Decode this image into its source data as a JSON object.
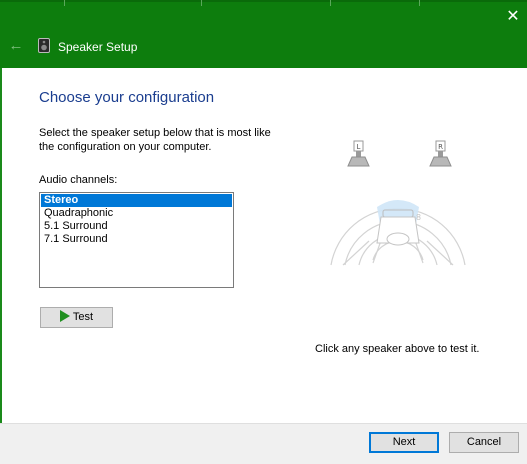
{
  "window": {
    "title": "Speaker Setup",
    "close_glyph": "✕",
    "back_glyph": "←"
  },
  "main": {
    "heading": "Choose your configuration",
    "description": "Select the speaker setup below that is most like the configuration on your computer.",
    "channels_label": "Audio channels:",
    "channels": [
      {
        "label": "Stereo",
        "selected": true
      },
      {
        "label": "Quadraphonic",
        "selected": false
      },
      {
        "label": "5.1 Surround",
        "selected": false
      },
      {
        "label": "7.1 Surround",
        "selected": false
      }
    ],
    "test_label": "Test",
    "hint": "Click any speaker above to test it."
  },
  "diagram": {
    "left_speaker_letter": "L",
    "right_speaker_letter": "R"
  },
  "footer": {
    "next_label": "Next",
    "cancel_label": "Cancel"
  },
  "colors": {
    "titlebar": "#0d7d0d",
    "accent": "#0078d7",
    "heading": "#1a3d8f",
    "play": "#1f8f1f"
  }
}
